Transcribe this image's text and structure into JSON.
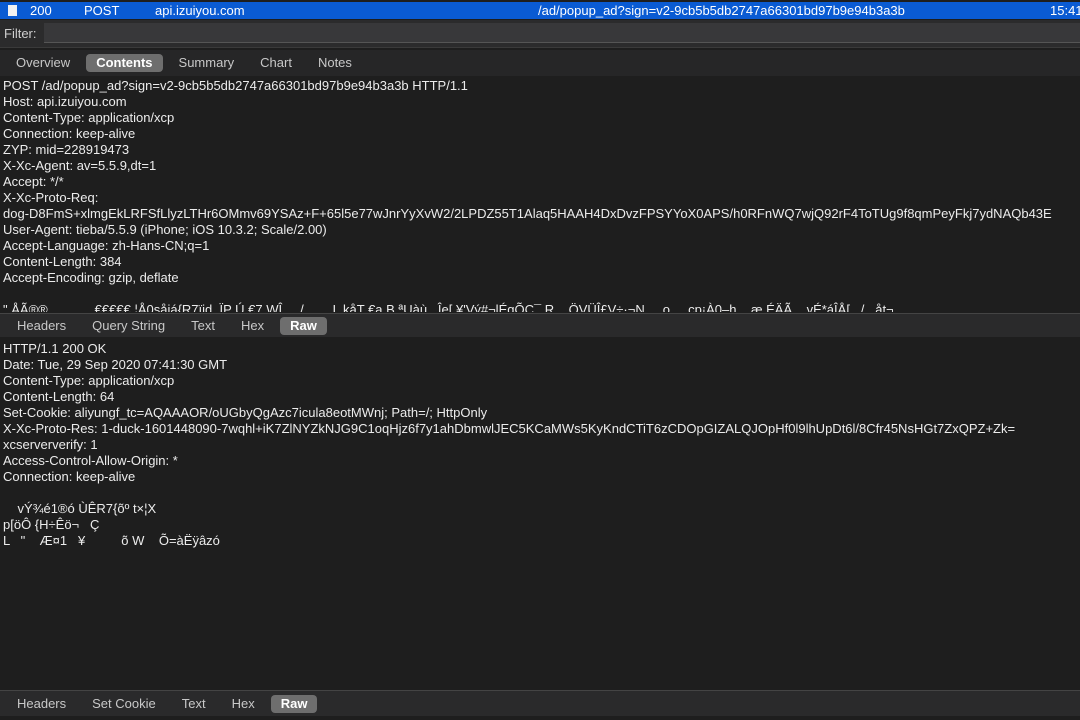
{
  "session_row": {
    "status": "200",
    "method": "POST",
    "host": "api.izuiyou.com",
    "path": "/ad/popup_ad?sign=v2-9cb5b5db2747a66301bd97b9e94b3a3b",
    "time": "15:41"
  },
  "filter": {
    "label": "Filter:",
    "value": ""
  },
  "main_tabs": [
    "Overview",
    "Contents",
    "Summary",
    "Chart",
    "Notes"
  ],
  "active_main_tab": "Contents",
  "request_lines": [
    "POST /ad/popup_ad?sign=v2-9cb5b5db2747a66301bd97b9e94b3a3b HTTP/1.1",
    "Host: api.izuiyou.com",
    "Content-Type: application/xcp",
    "Connection: keep-alive",
    "ZYP: mid=228919473",
    "X-Xc-Agent: av=5.5.9,dt=1",
    "Accept: */*",
    "X-Xc-Proto-Req:",
    "dog-D8FmS+xlmgEkLRFSfLlyzLTHr6OMmv69YSAz+F+65l5e77wJnrYyXvW2/2LPDZ55T1Alaq5HAAH4DxDvzFPSYYoX0APS/h0RFnWQ7wjQ92rF4ToTUg9f8qmPeyFkj7ydNAQb43E",
    "User-Agent: tieba/5.5.9 (iPhone; iOS 10.3.2; Scale/2.00)",
    "Accept-Language: zh-Hans-CN;q=1",
    "Content-Length: 384",
    "Accept-Encoding: gzip, deflate",
    "",
    "\" ÅÃ®®             €€€€€ ¦Å0såiá{R7ïid  ÏP Ú €7 WÎ     /        L kåT €a B ªUàù   Îe[ ¥'Vý#¬lÉqÕC¯ R    ÖVÜÎ£V÷·¬N     o     cp¡À0–h    æ ÉÄÃ    vÉ*áÎÅ[   /   åt¬"
  ],
  "request_tabs": [
    "Headers",
    "Query String",
    "Text",
    "Hex",
    "Raw"
  ],
  "active_request_tab": "Raw",
  "response_lines": [
    "HTTP/1.1 200 OK",
    "Date: Tue, 29 Sep 2020 07:41:30 GMT",
    "Content-Type: application/xcp",
    "Content-Length: 64",
    "Set-Cookie: aliyungf_tc=AQAAAOR/oUGbyQgAzc7icula8eotMWnj; Path=/; HttpOnly",
    "X-Xc-Proto-Res: 1-duck-1601448090-7wqhl+iK7ZlNYZkNJG9C1oqHjz6f7y1ahDbmwlJEC5KCaMWs5KyKndCTiT6zCDOpGIZALQJOpHf0l9lhUpDt6l/8Cfr45NsHGt7ZxQPZ+Zk=",
    "xcserververify: 1",
    "Access-Control-Allow-Origin: *",
    "Connection: keep-alive",
    "",
    "    vÝ¾é1®ó ÙÊR7{õº t×¦X",
    "p[öÔ {H÷Êö¬   Ç",
    "L   \"    Æ¤1   ¥          õ W    Õ=àËÿâzó"
  ],
  "response_tabs": [
    "Headers",
    "Set Cookie",
    "Text",
    "Hex",
    "Raw"
  ],
  "active_response_tab": "Raw"
}
